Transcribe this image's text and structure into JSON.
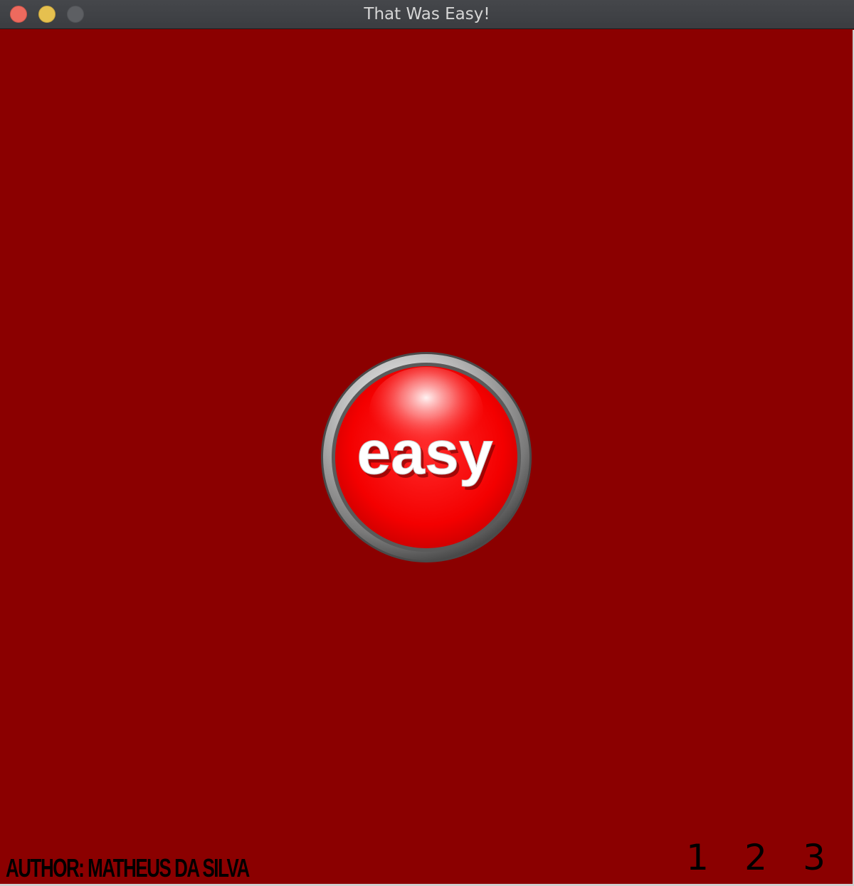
{
  "window": {
    "title": "That Was Easy!"
  },
  "button": {
    "label": "easy",
    "icon": "easy-button-icon"
  },
  "footer": {
    "author": "AUTHOR: MATHEUS DA SILVA",
    "levels": [
      "1",
      "2",
      "3"
    ]
  },
  "colors": {
    "background": "#8b0000",
    "button_red": "#ff1a1a",
    "text": "#000000"
  }
}
